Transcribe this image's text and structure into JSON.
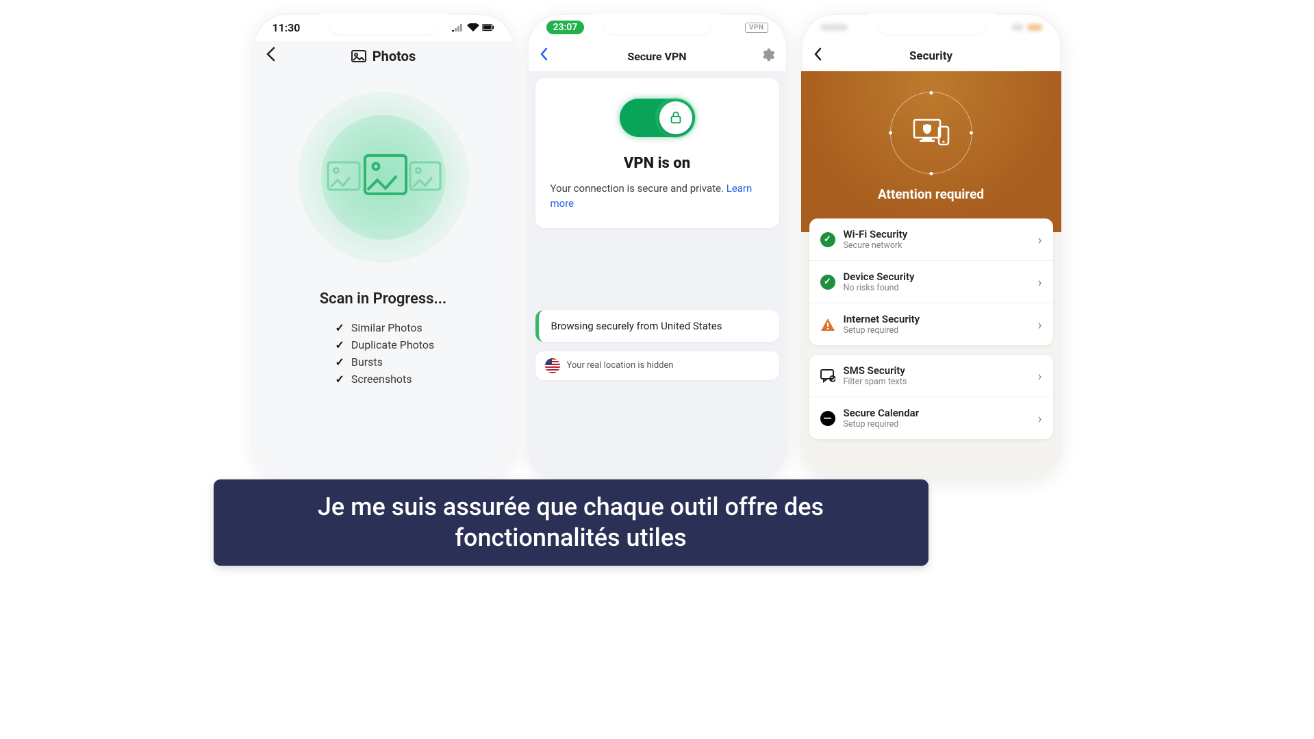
{
  "caption": "Je me suis assurée que chaque outil offre des fonctionnalités utiles",
  "phone1": {
    "time": "11:30",
    "nav_title": "Photos",
    "scan_title": "Scan in Progress...",
    "items": [
      "Similar Photos",
      "Duplicate Photos",
      "Bursts",
      "Screenshots"
    ]
  },
  "phone2": {
    "time": "23:07",
    "vpn_badge": "VPN",
    "nav_title": "Secure VPN",
    "heading": "VPN is on",
    "description": "Your connection is secure and private. ",
    "learn_more": "Learn more",
    "browsing": "Browsing securely from United States",
    "real_location": "Your real location is hidden"
  },
  "phone3": {
    "nav_title": "Security",
    "attention": "Attention required",
    "rows": [
      {
        "title": "Wi-Fi Security",
        "sub": "Secure network",
        "status": "ok"
      },
      {
        "title": "Device Security",
        "sub": "No risks found",
        "status": "ok"
      },
      {
        "title": "Internet Security",
        "sub": "Setup required",
        "status": "warn"
      },
      {
        "title": "SMS Security",
        "sub": "Filter spam texts",
        "status": "sms"
      },
      {
        "title": "Secure Calendar",
        "sub": "Setup required",
        "status": "dash"
      }
    ]
  }
}
